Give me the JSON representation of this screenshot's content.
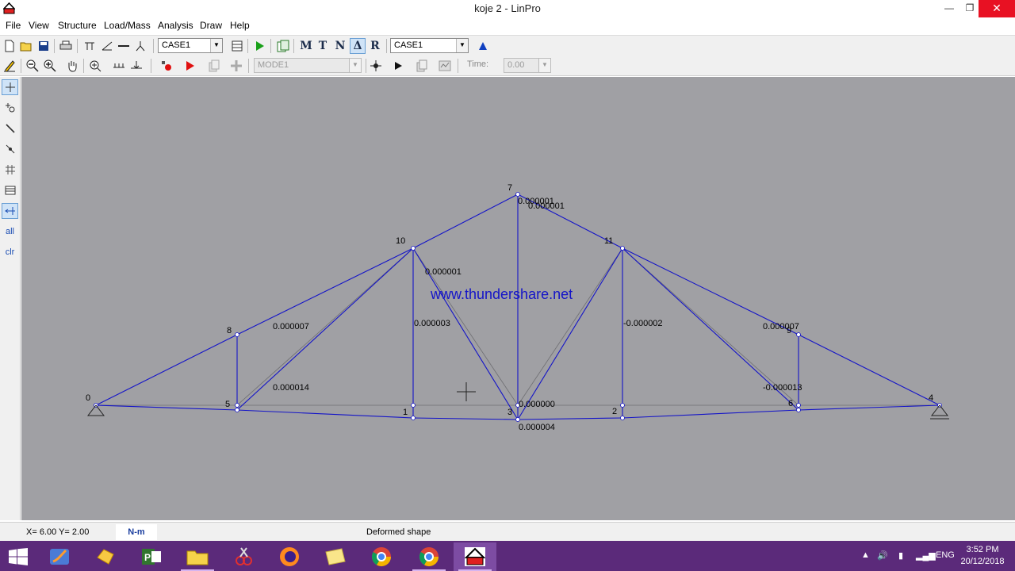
{
  "window": {
    "title": "koje 2 - LinPro",
    "minimize": "—",
    "maximize": "❐",
    "close": "✕"
  },
  "menu": [
    "File",
    "View",
    "Structure",
    "Load/Mass",
    "Analysis",
    "Draw",
    "Help"
  ],
  "toolbar1": {
    "case_combo_a": "CASE1",
    "letters": [
      "M",
      "T",
      "N",
      "Δ",
      "R"
    ],
    "case_combo_b": "CASE1"
  },
  "toolbar2": {
    "mode_combo": "MODE1",
    "time_label": "Time:",
    "time_value": "0.00"
  },
  "left_tools": {
    "all": "all",
    "clr": "clr"
  },
  "structure": {
    "watermark": "www.thundershare.net",
    "node_labels": [
      "0",
      "1",
      "2",
      "3",
      "4",
      "5",
      "6",
      "7",
      "8",
      "9",
      "10",
      "11"
    ],
    "member_values": [
      "0.000001",
      "0.000001",
      "0.000001",
      "0.000007",
      "0.000003",
      "-0.000002",
      "0.000007",
      "0.000014",
      "-0.000013",
      "0.000000",
      "0.000004"
    ],
    "line_color": "#1414c8",
    "background": "#a0a0a4"
  },
  "status": {
    "coords": "X= 6.00  Y= 2.00",
    "units": "N-m",
    "mode": "Deformed shape"
  },
  "taskbar": {
    "tray_lang": "ENG",
    "time": "3:52 PM",
    "date": "20/12/2018",
    "accent": "#5b2a7a"
  }
}
